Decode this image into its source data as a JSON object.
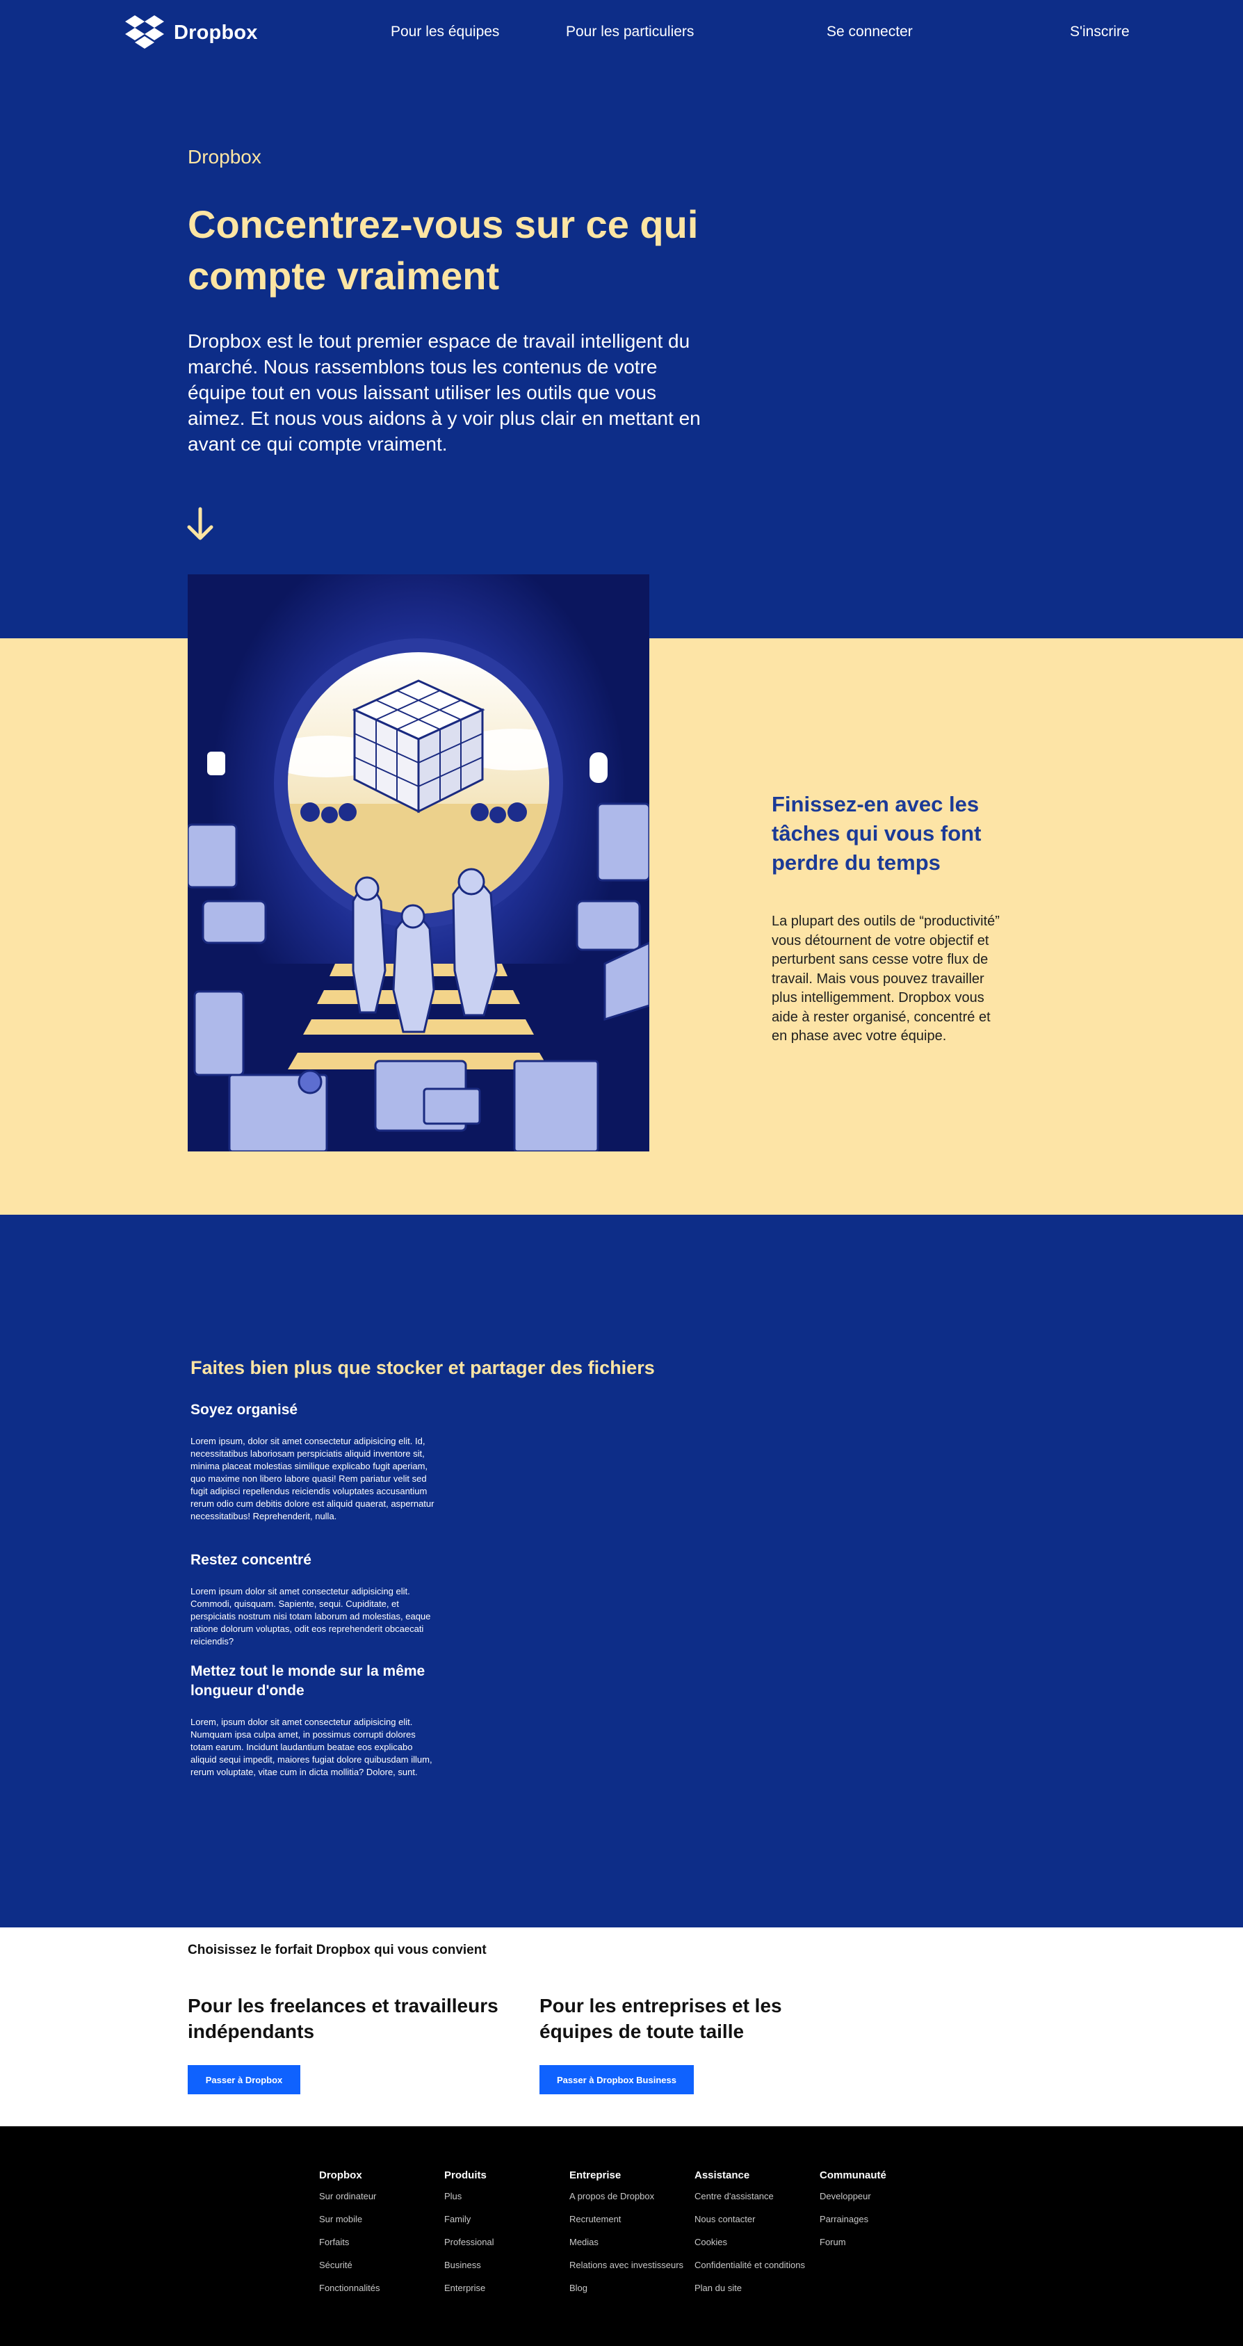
{
  "nav": {
    "brand": "Dropbox",
    "links": [
      "Pour les équipes",
      "Pour les particuliers",
      "Se connecter",
      "S'inscrire"
    ]
  },
  "hero": {
    "brand": "Dropbox",
    "title": "Concentrez-vous sur ce qui compte vraiment",
    "description": "Dropbox est le tout premier espace de travail intelligent du marché. Nous rassemblons tous les contenus de votre équipe tout en vous laissant utiliser les outils que vous aimez. Et nous vous aidons à y voir plus clair en mettant en avant ce qui compte vraiment."
  },
  "feature": {
    "title": "Finissez-en avec les tâches qui vous font perdre du temps",
    "description": "La plupart des outils de “productivité” vous détournent de votre objectif et perturbent sans cesse votre flux de travail. Mais vous pouvez travailler plus intelligemment. Dropbox vous aide à rester organisé, concentré et en phase avec votre équipe."
  },
  "more": {
    "title": "Faites bien plus que stocker et partager des fichiers",
    "items": [
      {
        "heading": "Soyez organisé",
        "text": "Lorem ipsum, dolor sit amet consectetur adipisicing elit. Id, necessitatibus laboriosam perspiciatis aliquid inventore sit, minima placeat molestias similique explicabo fugit aperiam, quo maxime non libero labore quasi! Rem pariatur velit sed fugit adipisci repellendus reiciendis voluptates accusantium rerum odio cum debitis dolore est aliquid quaerat, aspernatur necessitatibus! Reprehenderit, nulla."
      },
      {
        "heading": "Restez concentré",
        "text": "Lorem ipsum dolor sit amet consectetur adipisicing elit. Commodi, quisquam. Sapiente, sequi. Cupiditate, et perspiciatis nostrum nisi totam laborum ad molestias, eaque ratione dolorum voluptas, odit eos reprehenderit obcaecati reiciendis?"
      },
      {
        "heading": "Mettez tout le monde sur la même longueur d'onde",
        "text": "Lorem, ipsum dolor sit amet consectetur adipisicing elit. Numquam ipsa culpa amet, in possimus corrupti dolores totam earum. Incidunt laudantium beatae eos explicabo aliquid sequi impedit, maiores fugiat dolore quibusdam illum, rerum voluptate, vitae cum in dicta mollitia? Dolore, sunt."
      }
    ]
  },
  "plans": {
    "heading": "Choisissez le forfait Dropbox qui vous convient",
    "items": [
      {
        "title": "Pour les freelances et travailleurs indépendants",
        "button": "Passer à Dropbox"
      },
      {
        "title": "Pour les entreprises et les équipes de toute taille",
        "button": "Passer à Dropbox Business"
      }
    ]
  },
  "footer": {
    "columns": [
      {
        "heading": "Dropbox",
        "links": [
          "Sur ordinateur",
          "Sur mobile",
          "Forfaits",
          "Sécurité",
          "Fonctionnalités"
        ]
      },
      {
        "heading": "Produits",
        "links": [
          "Plus",
          "Family",
          "Professional",
          "Business",
          "Enterprise"
        ]
      },
      {
        "heading": "Entreprise",
        "links": [
          "A propos de Dropbox",
          "Recrutement",
          "Medias",
          "Relations avec investisseurs",
          "Blog"
        ]
      },
      {
        "heading": "Assistance",
        "links": [
          "Centre d'assistance",
          "Nous contacter",
          "Cookies",
          "Confidentialité et conditions",
          "Plan du site"
        ]
      },
      {
        "heading": "Communauté",
        "links": [
          "Developpeur",
          "Parrainages",
          "Forum"
        ]
      }
    ]
  },
  "colors": {
    "blue": "#0d2d88",
    "yellow": "#fde4a6",
    "button": "#0f62fe",
    "footer": "#000000"
  }
}
